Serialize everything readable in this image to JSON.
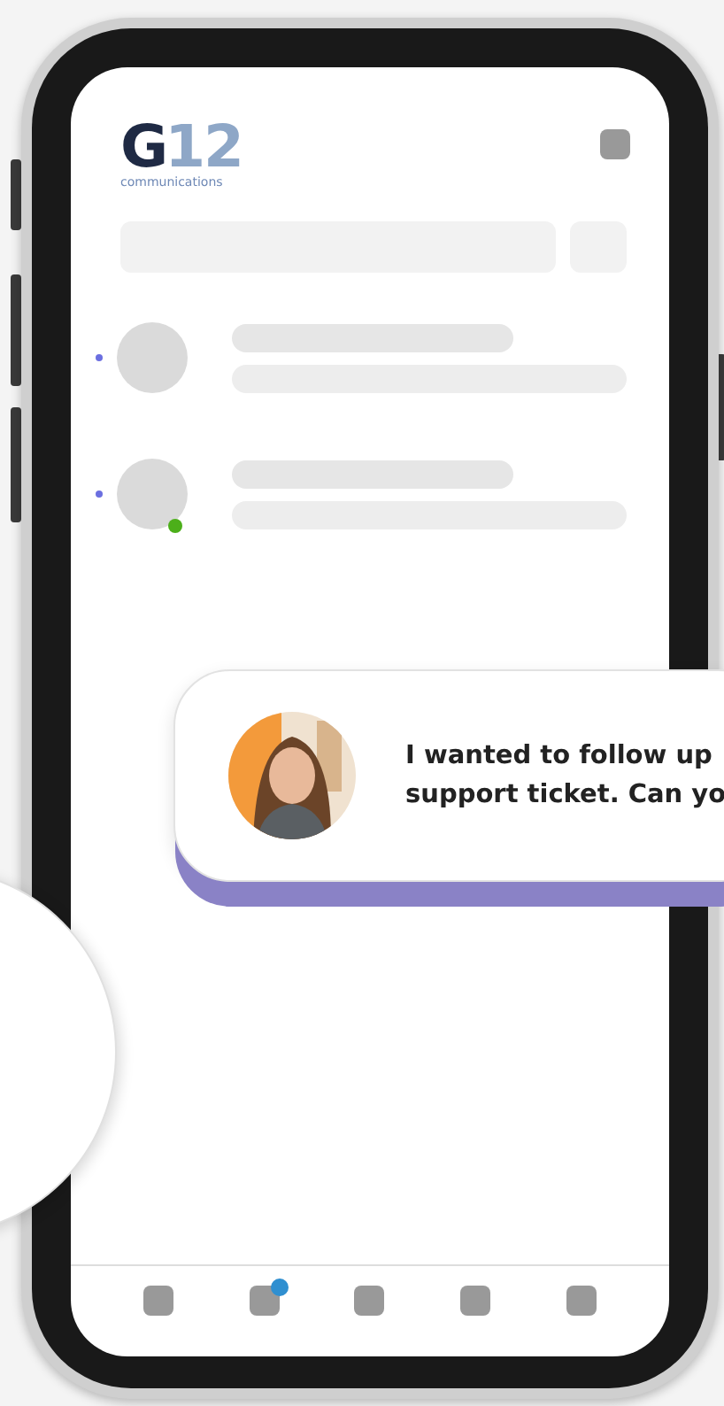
{
  "logo": {
    "mark": "G",
    "number": "12",
    "tagline": "communications"
  },
  "contacts": [
    {
      "unread": true,
      "online": false
    },
    {
      "unread": true,
      "online": true
    }
  ],
  "message": {
    "lines": [
      "I wanted to follow up",
      "support ticket. Can yo"
    ]
  },
  "tabs": [
    {
      "badge": false
    },
    {
      "badge": true
    },
    {
      "badge": false
    },
    {
      "badge": false
    },
    {
      "badge": false
    }
  ]
}
